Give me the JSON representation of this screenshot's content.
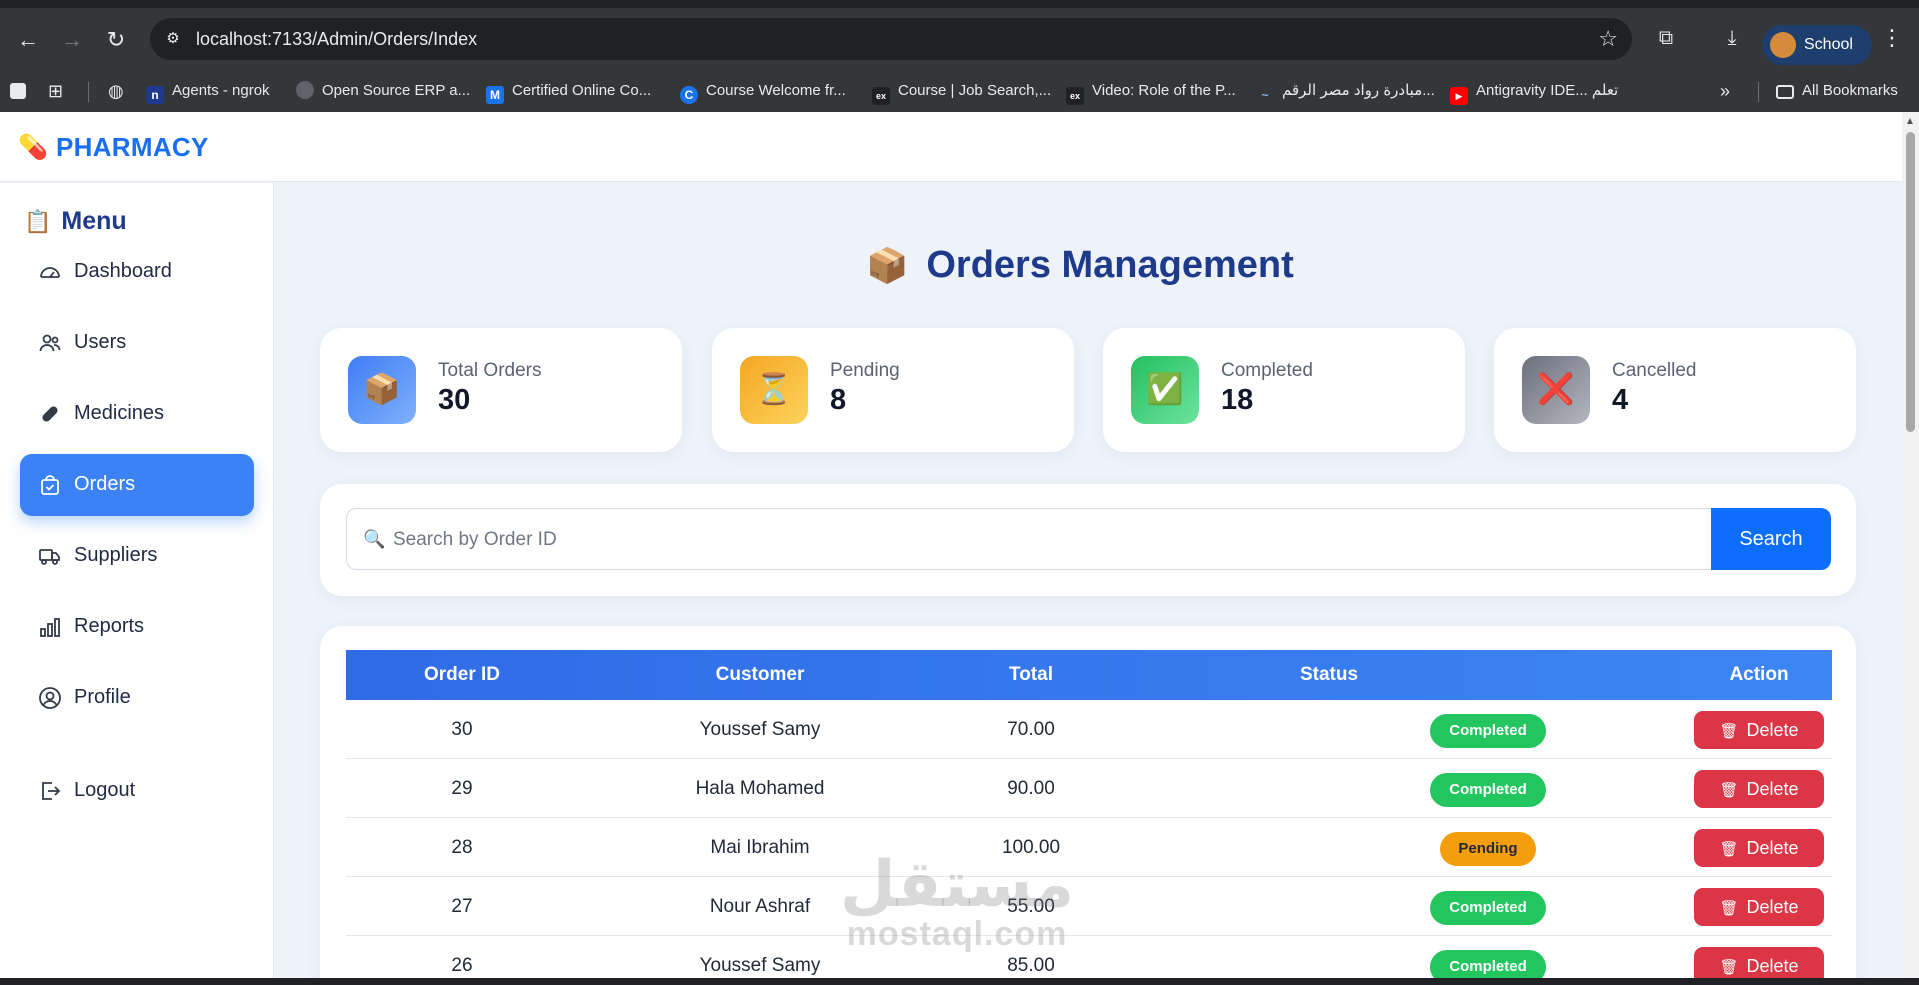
{
  "browser": {
    "url": "localhost:7133/Admin/Orders/Index",
    "profile_name": "School",
    "bookmarks": [
      {
        "label": "Agents - ngrok",
        "icon": "n",
        "color": "#1f3b8f"
      },
      {
        "label": "Open Source ERP a...",
        "icon": "o",
        "color": "#5f6368"
      },
      {
        "label": "Certified Online Co...",
        "icon": "M",
        "color": "#1a73e8"
      },
      {
        "label": "Course Welcome fr...",
        "icon": "C",
        "color": "#1a73e8"
      },
      {
        "label": "Course | Job Search,...",
        "icon": "ex",
        "color": "#202124"
      },
      {
        "label": "Video: Role of the P...",
        "icon": "ex",
        "color": "#202124"
      },
      {
        "label": "مبادرة رواد مصر الرقم...",
        "icon": "~",
        "color": "#35363a"
      },
      {
        "label": "Antigravity IDE... تعلم",
        "icon": "▶",
        "color": "#ff0000"
      }
    ],
    "all_bookmarks_label": "All Bookmarks"
  },
  "app": {
    "brand": "PHARMACY",
    "menu_title": "Menu",
    "sidebar": [
      {
        "label": "Dashboard",
        "icon": "gauge-icon"
      },
      {
        "label": "Users",
        "icon": "users-icon"
      },
      {
        "label": "Medicines",
        "icon": "capsule-icon"
      },
      {
        "label": "Orders",
        "icon": "bag-check-icon",
        "active": true
      },
      {
        "label": "Suppliers",
        "icon": "truck-icon"
      },
      {
        "label": "Reports",
        "icon": "bar-chart-icon"
      },
      {
        "label": "Profile",
        "icon": "person-circle-icon"
      },
      {
        "label": "Logout",
        "icon": "logout-icon"
      }
    ],
    "page_title": "Orders Management",
    "stats": [
      {
        "label": "Total Orders",
        "value": "30",
        "icon": "📦",
        "color": "#4f8ef7"
      },
      {
        "label": "Pending",
        "value": "8",
        "icon": "⏳",
        "color": "#f6b027"
      },
      {
        "label": "Completed",
        "value": "18",
        "icon": "✅",
        "color": "#34c46a"
      },
      {
        "label": "Cancelled",
        "value": "4",
        "icon": "❌",
        "color": "#7d818c"
      }
    ],
    "search": {
      "placeholder": "Search by Order ID",
      "button": "Search"
    },
    "table": {
      "headers": [
        "Order ID",
        "Customer",
        "Total",
        "Status",
        "Action"
      ],
      "rows": [
        {
          "id": "30",
          "customer": "Youssef Samy",
          "total": "70.00",
          "status": "Completed",
          "action": "Delete"
        },
        {
          "id": "29",
          "customer": "Hala Mohamed",
          "total": "90.00",
          "status": "Completed",
          "action": "Delete"
        },
        {
          "id": "28",
          "customer": "Mai Ibrahim",
          "total": "100.00",
          "status": "Pending",
          "action": "Delete"
        },
        {
          "id": "27",
          "customer": "Nour Ashraf",
          "total": "55.00",
          "status": "Completed",
          "action": "Delete"
        },
        {
          "id": "26",
          "customer": "Youssef Samy",
          "total": "85.00",
          "status": "Completed",
          "action": "Delete"
        }
      ]
    },
    "watermark": {
      "line1": "مستقل",
      "line2": "mostaql.com"
    }
  }
}
